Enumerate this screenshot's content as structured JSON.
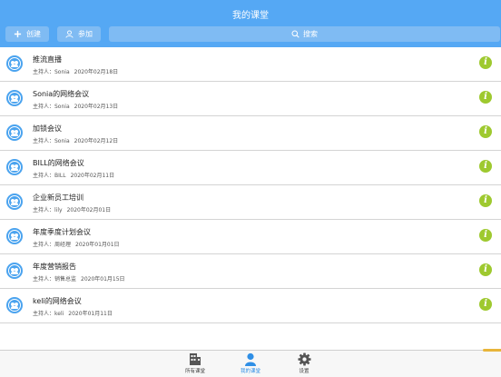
{
  "header": {
    "title": "我的课堂",
    "create_label": "创建",
    "join_label": "参加",
    "search_placeholder": "搜索"
  },
  "meetings": [
    {
      "name": "推流直播",
      "host": "主持人：Sonia",
      "date": "2020年02月18日"
    },
    {
      "name": "Sonia的网络会议",
      "host": "主持人：Sonia",
      "date": "2020年02月13日"
    },
    {
      "name": "加锁会议",
      "host": "主持人：Sonia",
      "date": "2020年02月12日"
    },
    {
      "name": "BILL的网络会议",
      "host": "主持人：BILL",
      "date": "2020年02月11日"
    },
    {
      "name": "企业新员工培训",
      "host": "主持人：lily",
      "date": "2020年02月01日"
    },
    {
      "name": "年度季度计划会议",
      "host": "主持人：周经理",
      "date": "2020年01月01日"
    },
    {
      "name": "年度营销报告",
      "host": "主持人：销售总监",
      "date": "2020年01月15日"
    },
    {
      "name": "keli的网络会议",
      "host": "主持人：keli",
      "date": "2020年01月11日"
    }
  ],
  "tabbar": {
    "all_label": "所有课堂",
    "mine_label": "我的课堂",
    "settings_label": "设置"
  },
  "colors": {
    "header": "#55a8f4",
    "avatar": "#4aa3ef",
    "info": "#9ec92f",
    "active_tab": "#2f8fe6"
  },
  "icons": [
    "plus-icon",
    "person-icon",
    "search-icon",
    "user-avatar-icon",
    "info-icon",
    "building-icon",
    "gear-icon"
  ]
}
